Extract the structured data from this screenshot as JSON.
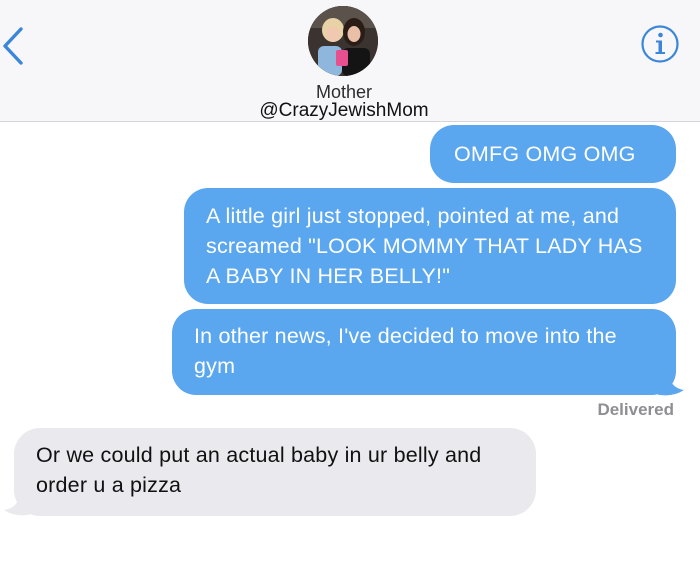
{
  "header": {
    "contact_name": "Mother",
    "contact_handle": "@CrazyJewishMom",
    "back_icon": "chevron-left-icon",
    "info_icon": "info-circle-icon"
  },
  "colors": {
    "sent_bubble": "#5aa7ef",
    "received_bubble": "#e9e9ee",
    "accent": "#3b86d8",
    "status_text": "#8e8e93"
  },
  "messages": [
    {
      "direction": "sent",
      "text": "OMFG OMG OMG"
    },
    {
      "direction": "sent",
      "text": "A little girl just stopped, pointed at me, and screamed \"LOOK MOMMY THAT LADY HAS A BABY IN HER BELLY!\""
    },
    {
      "direction": "sent",
      "text": "In other news, I've decided to move into the gym"
    },
    {
      "direction": "received",
      "text": "Or we could put an actual baby in ur belly and order u a pizza"
    }
  ],
  "status": {
    "delivered": "Delivered"
  }
}
